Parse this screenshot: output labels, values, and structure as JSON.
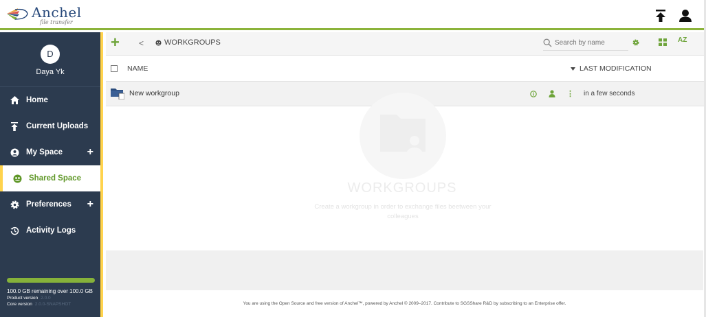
{
  "app": {
    "logo_name": "Anchel",
    "logo_tagline": "file transfer",
    "colors": {
      "accent": "#8bb33a",
      "sidebar": "#2c3b4f",
      "highlight": "#ffd34d",
      "active_text": "#5f9727"
    }
  },
  "topbar": {
    "upload_icon": "upload-icon",
    "user_icon": "user-icon"
  },
  "sidebar": {
    "avatar_initial": "D",
    "user_name": "Daya Yk",
    "items": [
      {
        "label": "Home",
        "icon": "home-icon",
        "active": false,
        "has_plus": false
      },
      {
        "label": "Current Uploads",
        "icon": "upload-icon",
        "active": false,
        "has_plus": false
      },
      {
        "label": "My Space",
        "icon": "user-circle-icon",
        "active": false,
        "has_plus": true
      },
      {
        "label": "Shared Space",
        "icon": "shared-icon",
        "active": true,
        "has_plus": false
      },
      {
        "label": "Preferences",
        "icon": "gear-icon",
        "active": false,
        "has_plus": true
      },
      {
        "label": "Activity Logs",
        "icon": "history-icon",
        "active": false,
        "has_plus": false
      }
    ],
    "plus_symbol": "+",
    "storage_text": "100.0 GB remaining over 100.0 GB",
    "storage_fill": 1.0,
    "product_version_label": "Product version",
    "product_version_value": "2.0.0",
    "core_version_label": "Core version",
    "core_version_value": "2.0.0-SNAPSHOT"
  },
  "toolbar": {
    "add_label": "+",
    "back_label": "<",
    "breadcrumb": "WORKGROUPS",
    "search_placeholder": "Search by name",
    "sort_label": "AZ"
  },
  "table": {
    "col_name": "NAME",
    "col_modified": "LAST MODIFICATION",
    "rows": [
      {
        "name": "New workgroup",
        "modified": "in a few seconds",
        "more": "⋮"
      }
    ]
  },
  "empty_state": {
    "title": "WORKGROUPS",
    "subtitle": "Create a workgroup in order to exchange files beetween your colleagues"
  },
  "footer": {
    "text": "You are using the Open Source and free version of Anchel™, powered by Anchel © 2009–2017. Contribute to SGSShare R&D by subscribing to an Enterprise offer."
  }
}
